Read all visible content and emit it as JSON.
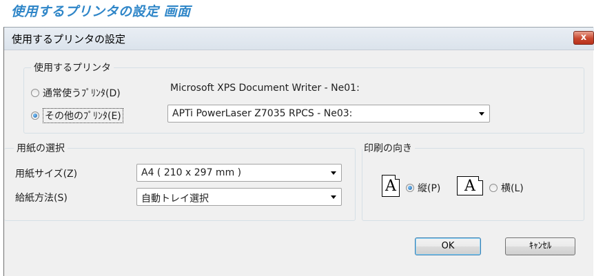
{
  "page_caption": "使用するプリンタの設定 画面",
  "window": {
    "title": "使用するプリンタの設定",
    "close_label": "x"
  },
  "printer_group": {
    "label": "使用するプリンタ",
    "normal_radio": {
      "label": "通常使うﾌﾟﾘﾝﾀ(D)",
      "checked": false
    },
    "normal_printer_name": "Microsoft XPS Document Writer - Ne01:",
    "other_radio": {
      "label": "その他のﾌﾟﾘﾝﾀ(E)",
      "checked": true
    },
    "other_printer_select": {
      "value": "APTi PowerLaser Z7035 RPCS - Ne03:"
    }
  },
  "paper_group": {
    "label": "用紙の選択",
    "size_label": "用紙サイズ(Z)",
    "size_value": "A4 ( 210 x 297 mm )",
    "feed_label": "給紙方法(S)",
    "feed_value": "自動トレイ選択"
  },
  "orientation_group": {
    "label": "印刷の向き",
    "portrait_icon_glyph": "A",
    "portrait_label": "縦(P)",
    "portrait_checked": true,
    "landscape_icon_glyph": "A",
    "landscape_label": "横(L)",
    "landscape_checked": false
  },
  "buttons": {
    "ok": "OK",
    "cancel": "ｷｬﾝｾﾙ"
  }
}
